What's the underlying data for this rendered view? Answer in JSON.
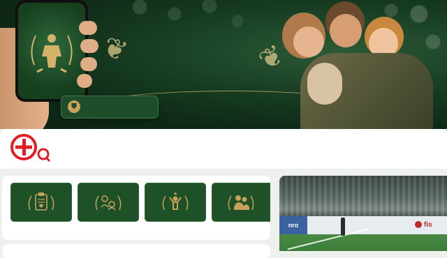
{
  "hero": {
    "badge_icon": "shield-icon"
  },
  "logo": {
    "name": "plus-search-logo",
    "color": "#e01e26"
  },
  "tiles": [
    {
      "icon": "clipboard-heart-icon"
    },
    {
      "icon": "connection-icon"
    },
    {
      "icon": "celebrating-person-icon"
    },
    {
      "icon": "family-icon"
    }
  ],
  "photo": {
    "board_left": "nro",
    "board_right": "fis"
  },
  "colors": {
    "hero_green": "#173d22",
    "tile_green": "#1f5128",
    "gold": "#c8a25a",
    "brand_red": "#e01e26"
  }
}
